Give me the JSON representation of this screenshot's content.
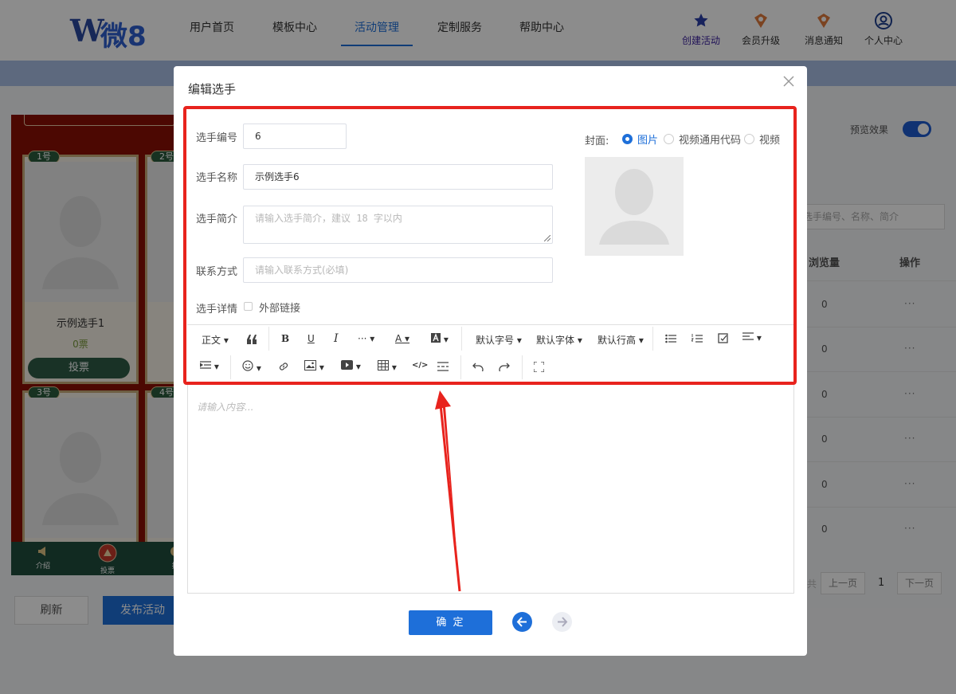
{
  "brand": {
    "logo_text": "微8"
  },
  "nav": [
    "用户首页",
    "模板中心",
    "活动管理",
    "定制服务",
    "帮助中心"
  ],
  "tools": [
    "创建活动",
    "会员升级",
    "消息通知",
    "个人中心"
  ],
  "phone": {
    "cards": [
      {
        "tag": "1号",
        "name": "示例选手1",
        "votes": "0票",
        "vote_btn": "投票"
      },
      {
        "tag": "2号"
      },
      {
        "tag": "3号"
      },
      {
        "tag": "4号"
      }
    ],
    "bottom_nav": [
      "介绍",
      "投票",
      "排"
    ]
  },
  "buttons": {
    "refresh": "刷新",
    "publish": "发布活动"
  },
  "right_panel": {
    "preview_label": "预览效果",
    "search_placeholder": "选手编号、名称、简介",
    "col_views": "浏览量",
    "col_ops": "操作",
    "rows": [
      "0",
      "0",
      "0",
      "0",
      "0",
      "0"
    ],
    "ops_glyph": "···",
    "pager": {
      "prev": "上一页",
      "page": "1",
      "next": "下一页",
      "ellipsis": "共"
    }
  },
  "modal": {
    "title": "编辑选手",
    "fields": {
      "number_label": "选手编号",
      "number_value": "6",
      "name_label": "选手名称",
      "name_value": "示例选手6",
      "intro_label": "选手简介",
      "intro_placeholder": "请输入选手简介，建议 18 字以内",
      "contact_label": "联系方式",
      "contact_placeholder": "请输入联系方式(必填)",
      "detail_label": "选手详情",
      "external_link": "外部链接"
    },
    "cover": {
      "label": "封面:",
      "options": [
        "图片",
        "视频通用代码",
        "视频"
      ],
      "selected": "图片"
    },
    "toolbar": {
      "paragraph": "正文",
      "font_size": "默认字号",
      "font_family": "默认字体",
      "line_height": "默认行高"
    },
    "editor_placeholder": "请输入内容...",
    "ok": "确 定"
  },
  "colors": {
    "accent": "#1e6fd9",
    "highlight": "#e8231d"
  }
}
